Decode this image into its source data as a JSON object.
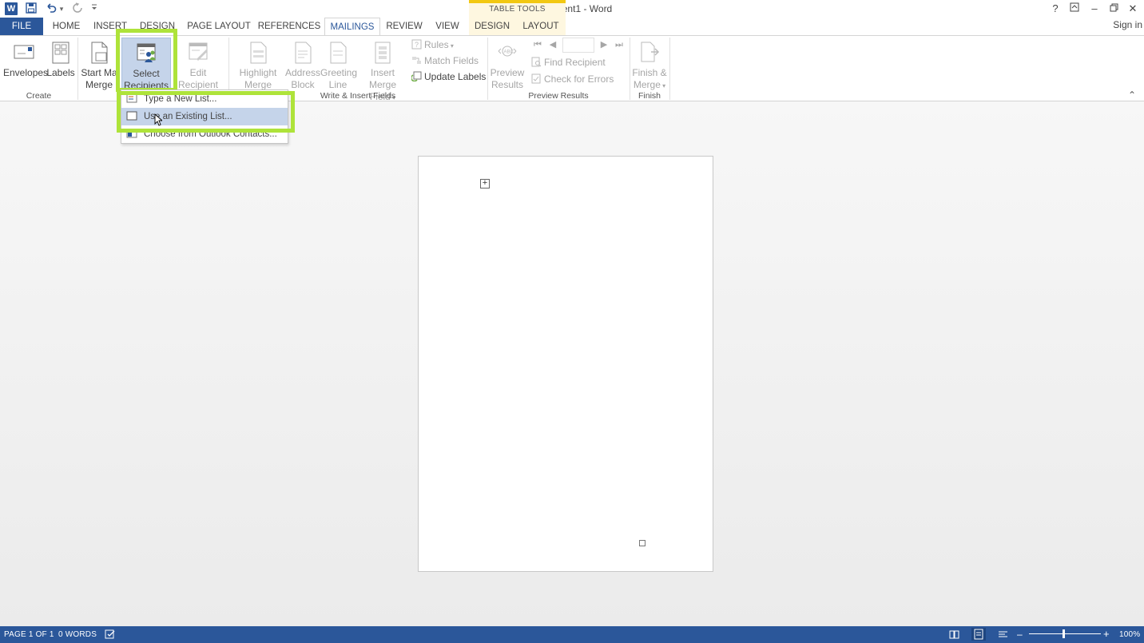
{
  "window": {
    "title": "Document1 - Word",
    "contextual_tab_header": "TABLE TOOLS",
    "sign_in": "Sign in",
    "help": "?",
    "ribbon_display": "⇧",
    "minimize": "–",
    "restore": "❐",
    "close": "✕"
  },
  "qat": {
    "logo": "W",
    "dropdown": "▾"
  },
  "tabs": [
    {
      "label": "FILE"
    },
    {
      "label": "HOME"
    },
    {
      "label": "INSERT"
    },
    {
      "label": "DESIGN"
    },
    {
      "label": "PAGE LAYOUT"
    },
    {
      "label": "REFERENCES"
    },
    {
      "label": "MAILINGS"
    },
    {
      "label": "REVIEW"
    },
    {
      "label": "VIEW"
    },
    {
      "label": "DESIGN"
    },
    {
      "label": "LAYOUT"
    }
  ],
  "ribbon": {
    "create": {
      "label": "Create",
      "envelopes": "Envelopes",
      "labels": "Labels"
    },
    "start": {
      "start_line1": "Start Ma",
      "start_line2": "Merge",
      "select_line1": "Select",
      "select_line2": "Recipients",
      "edit_line1": "Edit",
      "edit_line2": "Recipient List"
    },
    "write": {
      "label": "Write & Insert Fields",
      "highlight_line1": "Highlight",
      "highlight_line2": "Merge Fields",
      "address_line1": "Address",
      "address_line2": "Block",
      "greeting_line1": "Greeting",
      "greeting_line2": "Line",
      "insert_line1": "Insert Merge",
      "insert_line2": "Field",
      "rules": "Rules",
      "match_fields": "Match Fields",
      "update_labels": "Update Labels"
    },
    "preview": {
      "label": "Preview Results",
      "preview_line1": "Preview",
      "preview_line2": "Results",
      "find_recipient": "Find Recipient",
      "check_errors": "Check for Errors"
    },
    "finish": {
      "label": "Finish",
      "finish_line1": "Finish &",
      "finish_line2": "Merge"
    },
    "collapse": "⌃"
  },
  "dropdown": {
    "items": [
      {
        "label": "Type a New List..."
      },
      {
        "label": "Use an Existing List..."
      },
      {
        "label": "Choose from Outlook Contacts..."
      }
    ]
  },
  "statusbar": {
    "page": "PAGE 1 OF 1",
    "words": "0 WORDS",
    "zoom_minus": "–",
    "zoom_plus": "+",
    "zoom": "100%"
  },
  "colors": {
    "accent": "#2b579a",
    "highlight": "#aee33a",
    "menu_hover": "#c5d4ea",
    "contextual": "#f2c811"
  }
}
